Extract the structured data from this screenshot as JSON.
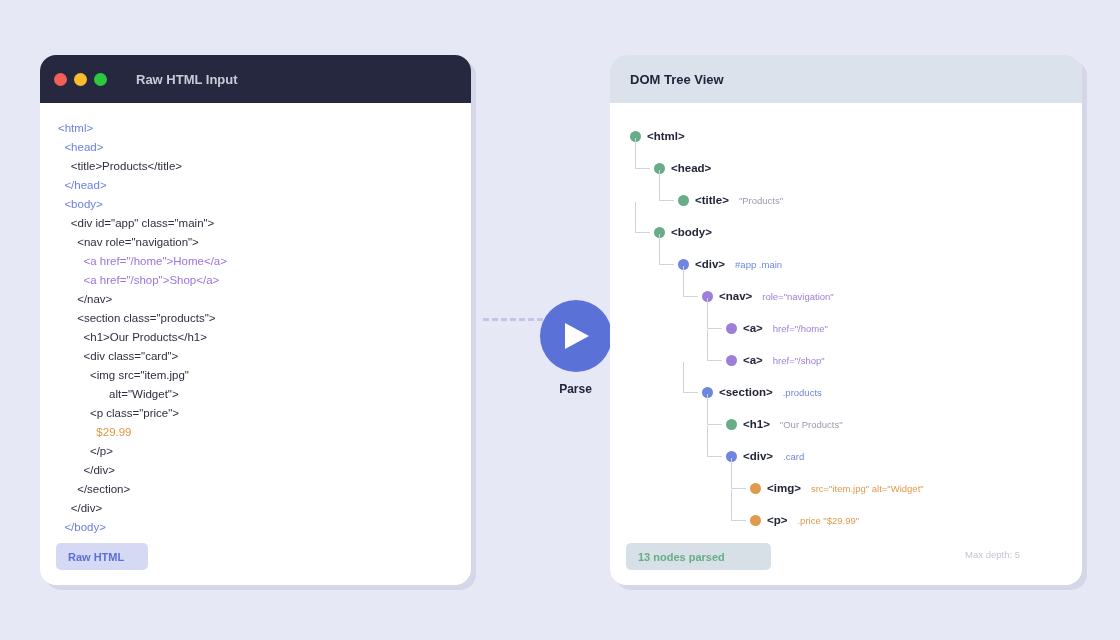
{
  "input_panel": {
    "title": "Raw HTML Input",
    "window_controls": [
      {
        "color": "#f25f58"
      },
      {
        "color": "#fbbb2e"
      },
      {
        "color": "#2ec840"
      }
    ],
    "code_lines": [
      {
        "text": "<html>",
        "kind": "tag"
      },
      {
        "text": "  <head>",
        "kind": "tag"
      },
      {
        "text": "    <title>Products</title>",
        "kind": "text"
      },
      {
        "text": "  </head>",
        "kind": "tag"
      },
      {
        "text": "  <body>",
        "kind": "tag"
      },
      {
        "text": "    <div id=\"app\" class=\"main\">",
        "kind": "text"
      },
      {
        "text": "      <nav role=\"navigation\">",
        "kind": "text"
      },
      {
        "text": "        <a href=\"/home\">Home</a>",
        "kind": "link"
      },
      {
        "text": "        <a href=\"/shop\">Shop</a>",
        "kind": "link"
      },
      {
        "text": "      </nav>",
        "kind": "text"
      },
      {
        "text": "      <section class=\"products\">",
        "kind": "text"
      },
      {
        "text": "        <h1>Our Products</h1>",
        "kind": "text"
      },
      {
        "text": "        <div class=\"card\">",
        "kind": "text"
      },
      {
        "text": "          <img src=\"item.jpg\"",
        "kind": "text"
      },
      {
        "text": "                alt=\"Widget\">",
        "kind": "text"
      },
      {
        "text": "          <p class=\"price\">",
        "kind": "text"
      },
      {
        "text": "            $29.99",
        "kind": "price"
      },
      {
        "text": "          </p>",
        "kind": "text"
      },
      {
        "text": "        </div>",
        "kind": "text"
      },
      {
        "text": "      </section>",
        "kind": "text"
      },
      {
        "text": "    </div>",
        "kind": "text"
      },
      {
        "text": "  </body>",
        "kind": "tag"
      }
    ],
    "badge": "Raw HTML"
  },
  "action": {
    "label": "Parse"
  },
  "tree_panel": {
    "title": "DOM Tree View",
    "tree": [
      {
        "tag": "<html>",
        "color": "#68ad87",
        "children": [
          {
            "tag": "<head>",
            "color": "#68ad87",
            "children": [
              {
                "tag": "<title>",
                "color": "#68ad87",
                "detail": "\"Products\"",
                "quoted_text": true
              }
            ]
          },
          {
            "tag": "<body>",
            "color": "#68ad87",
            "children": [
              {
                "tag": "<div>",
                "color": "#6f86df",
                "detail": "#app .main",
                "quoted_text": false,
                "children": [
                  {
                    "tag": "<nav>",
                    "color": "#9d7fd9",
                    "detail": "role=\"navigation\"",
                    "quoted_text": false,
                    "children": [
                      {
                        "tag": "<a>",
                        "color": "#9d7fd9",
                        "detail": "href=\"/home\"",
                        "quoted_text": false
                      },
                      {
                        "tag": "<a>",
                        "color": "#9d7fd9",
                        "detail": "href=\"/shop\"",
                        "quoted_text": false
                      }
                    ]
                  },
                  {
                    "tag": "<section>",
                    "color": "#6f86df",
                    "detail": ".products",
                    "quoted_text": false,
                    "children": [
                      {
                        "tag": "<h1>",
                        "color": "#68ad87",
                        "detail": "\"Our Products\"",
                        "quoted_text": true
                      },
                      {
                        "tag": "<div>",
                        "color": "#6f86df",
                        "detail": ".card",
                        "quoted_text": false,
                        "children": [
                          {
                            "tag": "<img>",
                            "color": "#e09a4c",
                            "detail": "src=\"item.jpg\" alt=\"Widget\"",
                            "quoted_text": false
                          },
                          {
                            "tag": "<p>",
                            "color": "#e09a4c",
                            "detail": ".price \"$29.99\"",
                            "quoted_text": false
                          }
                        ]
                      }
                    ]
                  }
                ]
              }
            ]
          }
        ]
      }
    ],
    "badge": "13 nodes parsed",
    "max_depth": "Max depth: 5"
  }
}
